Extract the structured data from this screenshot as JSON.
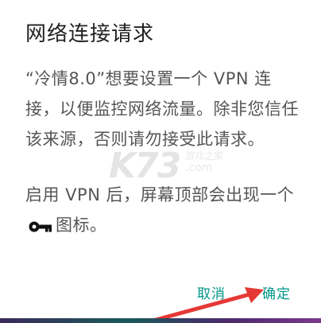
{
  "dialog": {
    "title": "网络连接请求",
    "message_p1": "“冷情8.0”想要设置一个 VPN 连接，以便监控网络流量。除非您信任该来源，否则请勿接受此请求。",
    "message_p2_before": "启用 VPN 后，屏幕顶部会出现一个",
    "message_p2_after": "图标。",
    "key_icon": "key-icon"
  },
  "buttons": {
    "cancel": "取消",
    "ok": "确定"
  },
  "watermark": {
    "logo": "K73",
    "tagline": "游戏之家",
    "domain": ".com"
  },
  "colors": {
    "accent": "#009688",
    "title": "#222222",
    "message": "#555555",
    "arrow": "#e53935"
  }
}
